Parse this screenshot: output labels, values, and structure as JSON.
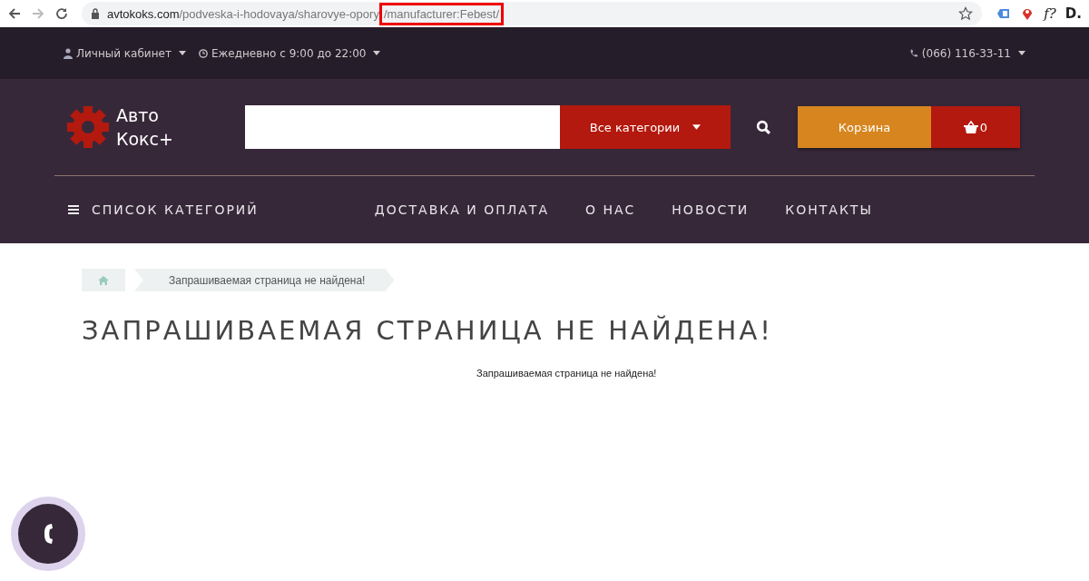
{
  "browser": {
    "url": "avtokoks.com/podveska-i-hodovaya/sharovye-opory",
    "url_highlighted": "/manufacturer:Febest/",
    "extension_labels": [
      "f?",
      "D."
    ]
  },
  "topbar": {
    "account": "Личный кабинет",
    "hours": "Ежедневно с 9:00 до 22:00",
    "phone": "(066) 116-33-11"
  },
  "header": {
    "logo_lines": [
      "Авто",
      "Кокс+"
    ],
    "search": {
      "category": "Все категории"
    },
    "cart": {
      "label": "Корзина",
      "count": "0"
    }
  },
  "nav": {
    "catalog": "СПИСОК КАТЕГОРИЙ",
    "links": [
      "ДОСТАВКА И ОПЛАТА",
      "О НАС",
      "НОВОСТИ",
      "КОНТАКТЫ"
    ]
  },
  "breadcrumb": [
    "Запрашиваемая страница не найдена!"
  ],
  "page": {
    "title": "ЗАПРАШИВАЕМАЯ СТРАНИЦА НЕ НАЙДЕНА!",
    "message": "Запрашиваемая страница не найдена!"
  }
}
